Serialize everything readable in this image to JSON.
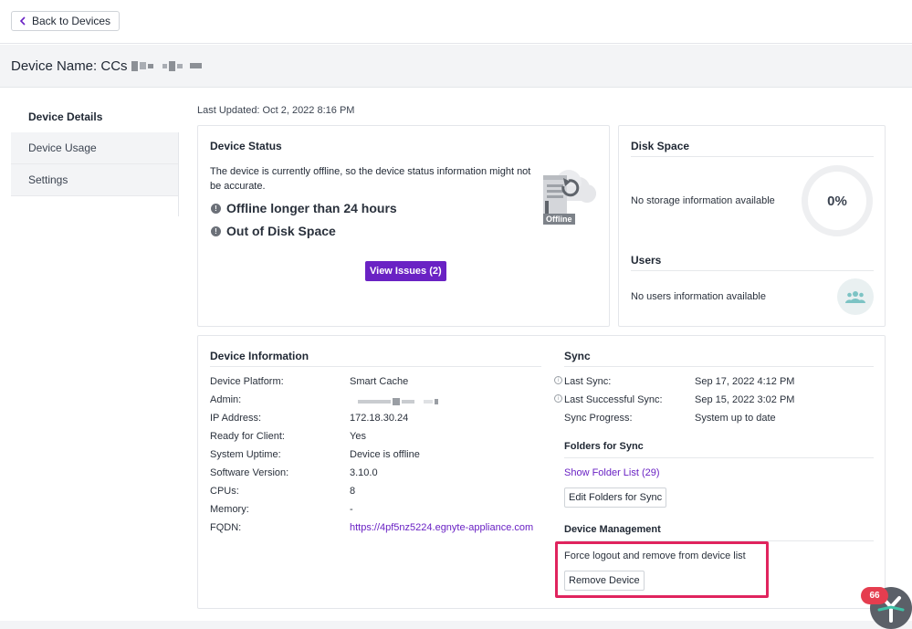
{
  "nav": {
    "back_label": "Back to Devices"
  },
  "header": {
    "device_name_label": "Device Name: CCs"
  },
  "sidebar": {
    "items": [
      {
        "label": "Device Details",
        "active": true
      },
      {
        "label": "Device Usage",
        "active": false
      },
      {
        "label": "Settings",
        "active": false
      }
    ]
  },
  "last_updated": "Last Updated: Oct 2, 2022 8:16 PM",
  "device_status": {
    "title": "Device Status",
    "message": "The device is currently offline, so the device status information might not be accurate.",
    "issues": [
      "Offline longer than 24 hours",
      "Out of Disk Space"
    ],
    "status_badge": "Offline",
    "view_issues_button": "View Issues (2)"
  },
  "disk_space": {
    "title": "Disk Space",
    "message": "No storage information available",
    "percent": "0%"
  },
  "users": {
    "title": "Users",
    "message": "No users information available"
  },
  "device_information": {
    "title": "Device Information",
    "rows": [
      {
        "label": "Device Platform:",
        "value": "Smart Cache"
      },
      {
        "label": "Admin:",
        "value": ""
      },
      {
        "label": "IP Address:",
        "value": "172.18.30.24"
      },
      {
        "label": "Ready for Client:",
        "value": "Yes"
      },
      {
        "label": "System Uptime:",
        "value": "Device is offline"
      },
      {
        "label": "Software Version:",
        "value": "3.10.0"
      },
      {
        "label": "CPUs:",
        "value": "8"
      },
      {
        "label": "Memory:",
        "value": "-"
      },
      {
        "label": "FQDN:",
        "value": "https://4pf5nz5224.egnyte-appliance.com"
      }
    ]
  },
  "sync": {
    "title": "Sync",
    "rows": [
      {
        "label": "Last Sync:",
        "value": "Sep 17, 2022 4:12 PM"
      },
      {
        "label": "Last Successful Sync:",
        "value": "Sep 15, 2022 3:02 PM"
      },
      {
        "label": "Sync Progress:",
        "value": "System up to date"
      }
    ]
  },
  "folders_for_sync": {
    "title": "Folders for Sync",
    "show_link": "Show Folder List (29)",
    "edit_button": "Edit Folders for Sync"
  },
  "device_management": {
    "title": "Device Management",
    "description": "Force logout and remove from device list",
    "remove_button": "Remove Device"
  },
  "notification_count": "66",
  "colors": {
    "accent": "#6a22c4",
    "highlight": "#e0245e",
    "badge": "#e53d4f"
  }
}
